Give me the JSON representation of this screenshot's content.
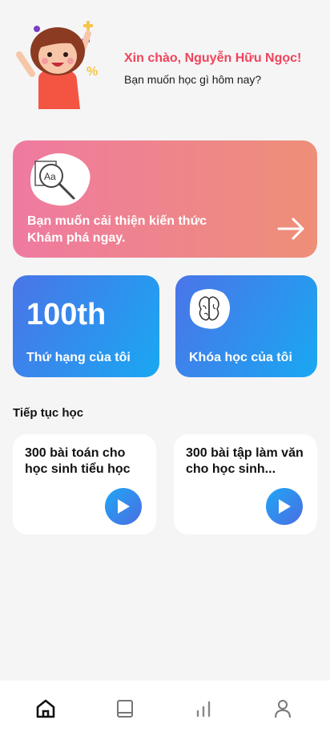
{
  "header": {
    "greeting": "Xin chào, Nguyễn Hữu Ngọc!",
    "subtitle": "Bạn muốn học gì hôm nay?"
  },
  "banner": {
    "line1": "Bạn muốn cải thiện kiến thức",
    "line2": "Khám phá ngay.",
    "icon": "dictionary-search-icon",
    "arrow_icon": "arrow-right-icon"
  },
  "rank_card": {
    "value": "100th",
    "label": "Thứ hạng của tôi"
  },
  "course_card": {
    "label": "Khóa học của tôi",
    "icon": "brain-icon"
  },
  "continue": {
    "title": "Tiếp tục học",
    "lessons": [
      {
        "title": "300 bài toán cho học sinh tiểu học"
      },
      {
        "title": "300 bài tập làm văn cho học sinh..."
      }
    ]
  },
  "nav": {
    "items": [
      "home-icon",
      "book-icon",
      "chart-icon",
      "profile-icon"
    ]
  },
  "colors": {
    "greeting": "#f0445a",
    "banner_start": "#ef7aa0",
    "banner_end": "#ee8f78",
    "card_start": "#4b74e8",
    "card_end": "#19a8f2"
  }
}
